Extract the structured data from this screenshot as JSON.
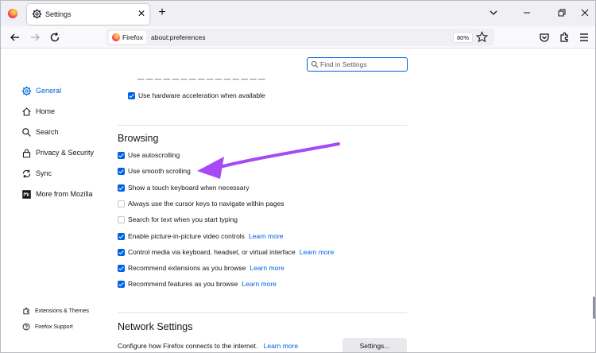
{
  "browser": {
    "tab_title": "Settings",
    "identity_label": "Firefox",
    "url": "about:preferences",
    "zoom": "80%"
  },
  "search": {
    "placeholder": "Find in Settings"
  },
  "sidebar": {
    "items": [
      {
        "label": "General",
        "active": true
      },
      {
        "label": "Home"
      },
      {
        "label": "Search"
      },
      {
        "label": "Privacy & Security"
      },
      {
        "label": "Sync"
      },
      {
        "label": "More from Mozilla"
      }
    ],
    "footer": [
      {
        "label": "Extensions & Themes"
      },
      {
        "label": "Firefox Support"
      }
    ]
  },
  "performance": {
    "hardware_acceleration": {
      "label": "Use hardware acceleration when available",
      "checked": true
    }
  },
  "browsing": {
    "title": "Browsing",
    "options": [
      {
        "label": "Use autoscrolling",
        "checked": true
      },
      {
        "label": "Use smooth scrolling",
        "checked": true
      },
      {
        "label": "Show a touch keyboard when necessary",
        "checked": true
      },
      {
        "label": "Always use the cursor keys to navigate within pages",
        "checked": false
      },
      {
        "label": "Search for text when you start typing",
        "checked": false
      },
      {
        "label": "Enable picture-in-picture video controls",
        "checked": true,
        "learn_more": "Learn more"
      },
      {
        "label": "Control media via keyboard, headset, or virtual interface",
        "checked": true,
        "learn_more": "Learn more"
      },
      {
        "label": "Recommend extensions as you browse",
        "checked": true,
        "learn_more": "Learn more"
      },
      {
        "label": "Recommend features as you browse",
        "checked": true,
        "learn_more": "Learn more"
      }
    ]
  },
  "network": {
    "title": "Network Settings",
    "description": "Configure how Firefox connects to the internet.",
    "learn_more": "Learn more",
    "button": "Settings..."
  },
  "colors": {
    "accent": "#0061e0",
    "annotation_arrow": "#a64bf4"
  }
}
